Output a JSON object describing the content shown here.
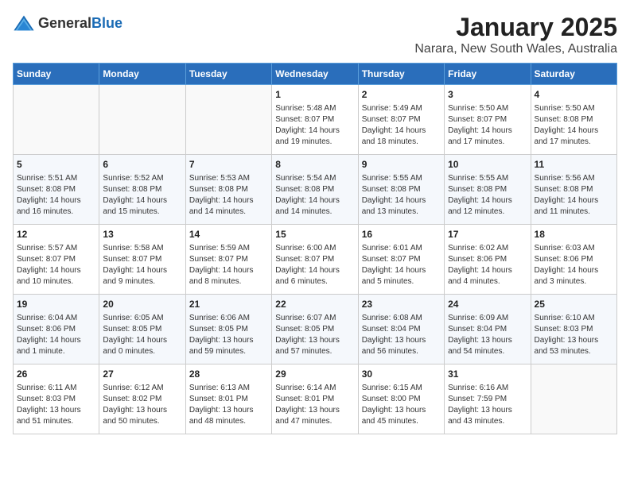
{
  "header": {
    "logo_line1": "General",
    "logo_line2": "Blue",
    "title": "January 2025",
    "subtitle": "Narara, New South Wales, Australia"
  },
  "weekdays": [
    "Sunday",
    "Monday",
    "Tuesday",
    "Wednesday",
    "Thursday",
    "Friday",
    "Saturday"
  ],
  "weeks": [
    [
      {
        "day": "",
        "info": ""
      },
      {
        "day": "",
        "info": ""
      },
      {
        "day": "",
        "info": ""
      },
      {
        "day": "1",
        "info": "Sunrise: 5:48 AM\nSunset: 8:07 PM\nDaylight: 14 hours\nand 19 minutes."
      },
      {
        "day": "2",
        "info": "Sunrise: 5:49 AM\nSunset: 8:07 PM\nDaylight: 14 hours\nand 18 minutes."
      },
      {
        "day": "3",
        "info": "Sunrise: 5:50 AM\nSunset: 8:07 PM\nDaylight: 14 hours\nand 17 minutes."
      },
      {
        "day": "4",
        "info": "Sunrise: 5:50 AM\nSunset: 8:08 PM\nDaylight: 14 hours\nand 17 minutes."
      }
    ],
    [
      {
        "day": "5",
        "info": "Sunrise: 5:51 AM\nSunset: 8:08 PM\nDaylight: 14 hours\nand 16 minutes."
      },
      {
        "day": "6",
        "info": "Sunrise: 5:52 AM\nSunset: 8:08 PM\nDaylight: 14 hours\nand 15 minutes."
      },
      {
        "day": "7",
        "info": "Sunrise: 5:53 AM\nSunset: 8:08 PM\nDaylight: 14 hours\nand 14 minutes."
      },
      {
        "day": "8",
        "info": "Sunrise: 5:54 AM\nSunset: 8:08 PM\nDaylight: 14 hours\nand 14 minutes."
      },
      {
        "day": "9",
        "info": "Sunrise: 5:55 AM\nSunset: 8:08 PM\nDaylight: 14 hours\nand 13 minutes."
      },
      {
        "day": "10",
        "info": "Sunrise: 5:55 AM\nSunset: 8:08 PM\nDaylight: 14 hours\nand 12 minutes."
      },
      {
        "day": "11",
        "info": "Sunrise: 5:56 AM\nSunset: 8:08 PM\nDaylight: 14 hours\nand 11 minutes."
      }
    ],
    [
      {
        "day": "12",
        "info": "Sunrise: 5:57 AM\nSunset: 8:07 PM\nDaylight: 14 hours\nand 10 minutes."
      },
      {
        "day": "13",
        "info": "Sunrise: 5:58 AM\nSunset: 8:07 PM\nDaylight: 14 hours\nand 9 minutes."
      },
      {
        "day": "14",
        "info": "Sunrise: 5:59 AM\nSunset: 8:07 PM\nDaylight: 14 hours\nand 8 minutes."
      },
      {
        "day": "15",
        "info": "Sunrise: 6:00 AM\nSunset: 8:07 PM\nDaylight: 14 hours\nand 6 minutes."
      },
      {
        "day": "16",
        "info": "Sunrise: 6:01 AM\nSunset: 8:07 PM\nDaylight: 14 hours\nand 5 minutes."
      },
      {
        "day": "17",
        "info": "Sunrise: 6:02 AM\nSunset: 8:06 PM\nDaylight: 14 hours\nand 4 minutes."
      },
      {
        "day": "18",
        "info": "Sunrise: 6:03 AM\nSunset: 8:06 PM\nDaylight: 14 hours\nand 3 minutes."
      }
    ],
    [
      {
        "day": "19",
        "info": "Sunrise: 6:04 AM\nSunset: 8:06 PM\nDaylight: 14 hours\nand 1 minute."
      },
      {
        "day": "20",
        "info": "Sunrise: 6:05 AM\nSunset: 8:05 PM\nDaylight: 14 hours\nand 0 minutes."
      },
      {
        "day": "21",
        "info": "Sunrise: 6:06 AM\nSunset: 8:05 PM\nDaylight: 13 hours\nand 59 minutes."
      },
      {
        "day": "22",
        "info": "Sunrise: 6:07 AM\nSunset: 8:05 PM\nDaylight: 13 hours\nand 57 minutes."
      },
      {
        "day": "23",
        "info": "Sunrise: 6:08 AM\nSunset: 8:04 PM\nDaylight: 13 hours\nand 56 minutes."
      },
      {
        "day": "24",
        "info": "Sunrise: 6:09 AM\nSunset: 8:04 PM\nDaylight: 13 hours\nand 54 minutes."
      },
      {
        "day": "25",
        "info": "Sunrise: 6:10 AM\nSunset: 8:03 PM\nDaylight: 13 hours\nand 53 minutes."
      }
    ],
    [
      {
        "day": "26",
        "info": "Sunrise: 6:11 AM\nSunset: 8:03 PM\nDaylight: 13 hours\nand 51 minutes."
      },
      {
        "day": "27",
        "info": "Sunrise: 6:12 AM\nSunset: 8:02 PM\nDaylight: 13 hours\nand 50 minutes."
      },
      {
        "day": "28",
        "info": "Sunrise: 6:13 AM\nSunset: 8:01 PM\nDaylight: 13 hours\nand 48 minutes."
      },
      {
        "day": "29",
        "info": "Sunrise: 6:14 AM\nSunset: 8:01 PM\nDaylight: 13 hours\nand 47 minutes."
      },
      {
        "day": "30",
        "info": "Sunrise: 6:15 AM\nSunset: 8:00 PM\nDaylight: 13 hours\nand 45 minutes."
      },
      {
        "day": "31",
        "info": "Sunrise: 6:16 AM\nSunset: 7:59 PM\nDaylight: 13 hours\nand 43 minutes."
      },
      {
        "day": "",
        "info": ""
      }
    ]
  ]
}
